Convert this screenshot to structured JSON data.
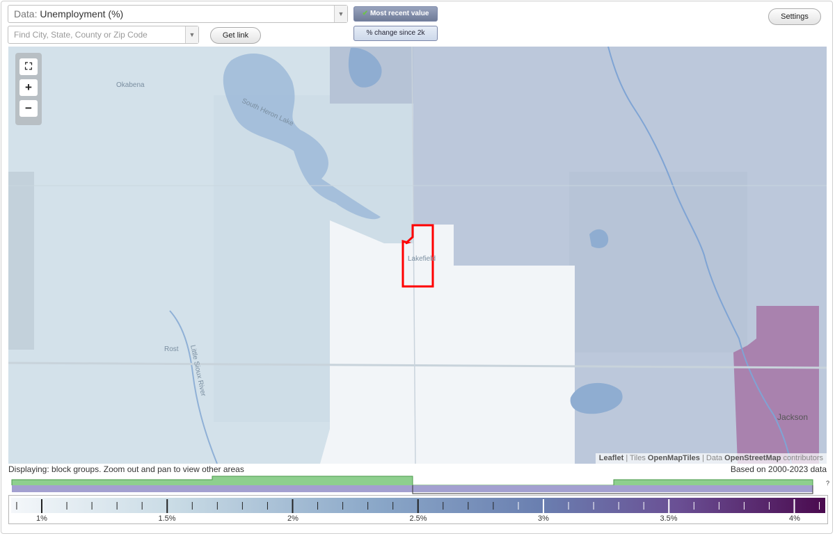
{
  "data_select": {
    "prefix": "Data: ",
    "value": "Unemployment (%)"
  },
  "search": {
    "placeholder": "Find City, State, County or Zip Code"
  },
  "buttons": {
    "get_link": "Get link",
    "settings": "Settings"
  },
  "toggles": {
    "most_recent": "Most recent value",
    "percent_change": "% change since 2k"
  },
  "map": {
    "places": [
      "Okabena",
      "South Heron Lake",
      "Lakefield",
      "Rost",
      "Little Sioux River",
      "Jackson"
    ],
    "attribution": {
      "leaflet": "Leaflet",
      "tiles_prefix": " | Tiles ",
      "tiles": "OpenMapTiles",
      "data_prefix": " | Data ",
      "data": "OpenStreetMap",
      "contrib": " contributors"
    },
    "zoom": {
      "fullscreen": "⛶",
      "plus": "+",
      "minus": "−"
    }
  },
  "status": {
    "displaying": "Displaying: block groups. Zoom out and pan to view other areas",
    "based_on": "Based on 2000-2023 data",
    "question": "?"
  },
  "legend": {
    "labels": [
      "1%",
      "1.5%",
      "2%",
      "2.5%",
      "3%",
      "3.5%",
      "4%"
    ],
    "gradient_start": "#f4f7fa",
    "gradient_mid": "#6a7fb0",
    "gradient_end": "#4a0a4e"
  },
  "colors": {
    "highlight": "#ff0000",
    "histogram_green": "#8ecf8e",
    "histogram_purple": "#a3a0d0"
  }
}
